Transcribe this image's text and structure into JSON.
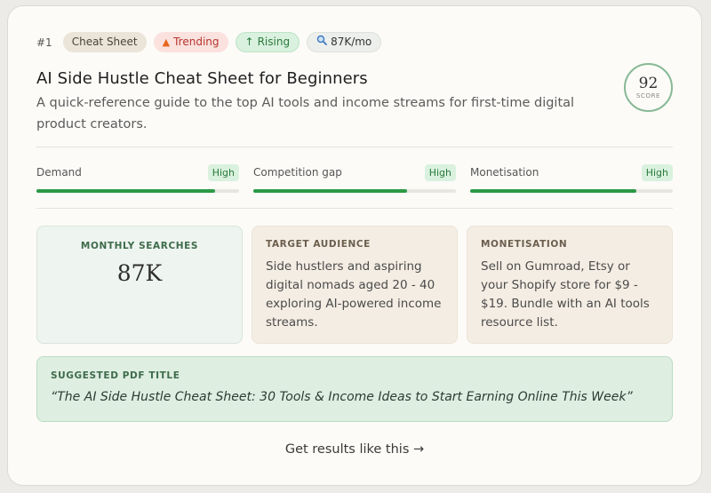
{
  "header": {
    "rank": "#1",
    "tags": {
      "category": "Cheat Sheet",
      "trending": "Trending",
      "rising": "Rising",
      "volume": "87K/mo"
    },
    "title": "AI Side Hustle Cheat Sheet for Beginners",
    "subtitle": "A quick-reference guide to the top AI tools and income streams for first-time digital product creators.",
    "score": {
      "value": "92",
      "label": "SCORE"
    }
  },
  "meters": [
    {
      "label": "Demand",
      "badge": "High",
      "level": 0.88
    },
    {
      "label": "Competition gap",
      "badge": "High",
      "level": 0.76
    },
    {
      "label": "Monetisation",
      "badge": "High",
      "level": 0.82
    }
  ],
  "boxes": {
    "searches": {
      "heading": "MONTHLY SEARCHES",
      "value": "87K"
    },
    "audience": {
      "heading": "TARGET AUDIENCE",
      "text": "Side hustlers and aspiring digital nomads aged 20 - 40 exploring AI-powered income streams."
    },
    "monetisation": {
      "heading": "MONETISATION",
      "text": "Sell on Gumroad, Etsy or your Shopify store for $9 - $19. Bundle with an AI tools resource list."
    }
  },
  "suggested": {
    "heading": "SUGGESTED PDF TITLE",
    "title": "“The AI Side Hustle Cheat Sheet: 30 Tools & Income Ideas to Start Earning Online This Week”"
  },
  "cta": "Get results like this →",
  "icons": {
    "trending": "flame-icon",
    "rising": "arrow-up-icon",
    "volume": "magnifier-icon"
  },
  "colors": {
    "accent_green": "#2c9a46",
    "trending_red": "#b5352d"
  }
}
